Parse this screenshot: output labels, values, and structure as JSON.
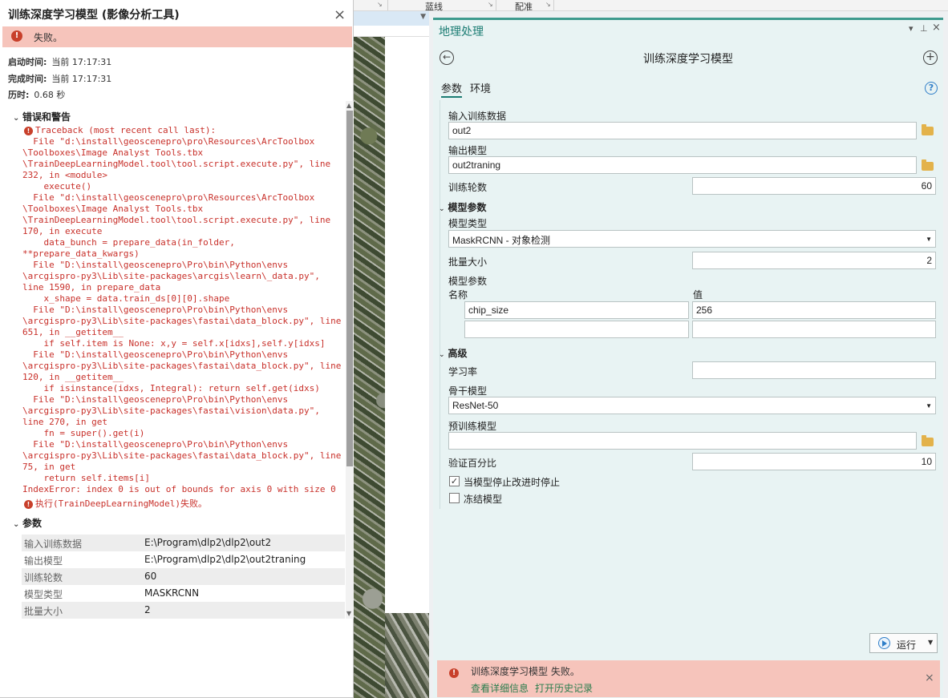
{
  "ribbon": {
    "group1": "蓝线",
    "group2": "配准"
  },
  "dialog": {
    "title": "训练深度学习模型 (影像分析工具)",
    "close": "×",
    "status": "失败。",
    "start_label": "启动时间:",
    "start_value": "当前 17:17:31",
    "end_label": "完成时间:",
    "end_value": "当前 17:17:31",
    "elapsed_label": "历时:",
    "elapsed_value": "0.68 秒",
    "errors_header": "错误和警告",
    "traceback_first": "Traceback (most recent call last):",
    "traceback_body": "  File \"d:\\install\\geoscenepro\\pro\\Resources\\ArcToolbox\n\\Toolboxes\\Image Analyst Tools.tbx\n\\TrainDeepLearningModel.tool\\tool.script.execute.py\", line\n232, in <module>\n    execute()\n  File \"d:\\install\\geoscenepro\\pro\\Resources\\ArcToolbox\n\\Toolboxes\\Image Analyst Tools.tbx\n\\TrainDeepLearningModel.tool\\tool.script.execute.py\", line\n170, in execute\n    data_bunch = prepare_data(in_folder,\n**prepare_data_kwargs)\n  File \"D:\\install\\geoscenepro\\Pro\\bin\\Python\\envs\n\\arcgispro-py3\\Lib\\site-packages\\arcgis\\learn\\_data.py\",\nline 1590, in prepare_data\n    x_shape = data.train_ds[0][0].shape\n  File \"D:\\install\\geoscenepro\\Pro\\bin\\Python\\envs\n\\arcgispro-py3\\Lib\\site-packages\\fastai\\data_block.py\", line\n651, in __getitem__\n    if self.item is None: x,y = self.x[idxs],self.y[idxs]\n  File \"D:\\install\\geoscenepro\\Pro\\bin\\Python\\envs\n\\arcgispro-py3\\Lib\\site-packages\\fastai\\data_block.py\", line\n120, in __getitem__\n    if isinstance(idxs, Integral): return self.get(idxs)\n  File \"D:\\install\\geoscenepro\\Pro\\bin\\Python\\envs\n\\arcgispro-py3\\Lib\\site-packages\\fastai\\vision\\data.py\",\nline 270, in get\n    fn = super().get(i)\n  File \"D:\\install\\geoscenepro\\Pro\\bin\\Python\\envs\n\\arcgispro-py3\\Lib\\site-packages\\fastai\\data_block.py\", line\n75, in get\n    return self.items[i]\nIndexError: index 0 is out of bounds for axis 0 with size 0",
    "exec_failed": "执行(TrainDeepLearningModel)失败。",
    "params_header": "参数",
    "params": [
      {
        "k": "输入训练数据",
        "v": "E:\\Program\\dlp2\\dlp2\\out2"
      },
      {
        "k": "输出模型",
        "v": "E:\\Program\\dlp2\\dlp2\\out2traning"
      },
      {
        "k": "训练轮数",
        "v": "60"
      },
      {
        "k": "模型类型",
        "v": "MASKRCNN"
      },
      {
        "k": "批量大小",
        "v": "2"
      }
    ]
  },
  "pane": {
    "title": "地理处理",
    "ctrl_menu": "▾",
    "ctrl_pin": "⊥",
    "ctrl_close": "×",
    "tool_title": "训练深度学习模型",
    "back": "←",
    "plus": "+",
    "tab_params": "参数",
    "tab_env": "环境",
    "help": "?",
    "input_label": "输入训练数据",
    "input_value": "out2",
    "output_label": "输出模型",
    "output_value": "out2traning",
    "epochs_label": "训练轮数",
    "epochs_value": "60",
    "model_params_header": "模型参数",
    "model_type_label": "模型类型",
    "model_type_value": "MaskRCNN - 对象检测",
    "batch_label": "批量大小",
    "batch_value": "2",
    "mp_label": "模型参数",
    "name_col": "名称",
    "value_col": "值",
    "mp_name1": "chip_size",
    "mp_value1": "256",
    "advanced_header": "高级",
    "lr_label": "学习率",
    "backbone_label": "骨干模型",
    "backbone_value": "ResNet-50",
    "pretrained_label": "预训练模型",
    "val_label": "验证百分比",
    "val_value": "10",
    "stop_label": "当模型停止改进时停止",
    "stop_checked": "✓",
    "freeze_label": "冻结模型",
    "run_label": "运行",
    "msg_text": "训练深度学习模型 失败。",
    "msg_link1": "查看详细信息",
    "msg_link2": "打开历史记录"
  }
}
